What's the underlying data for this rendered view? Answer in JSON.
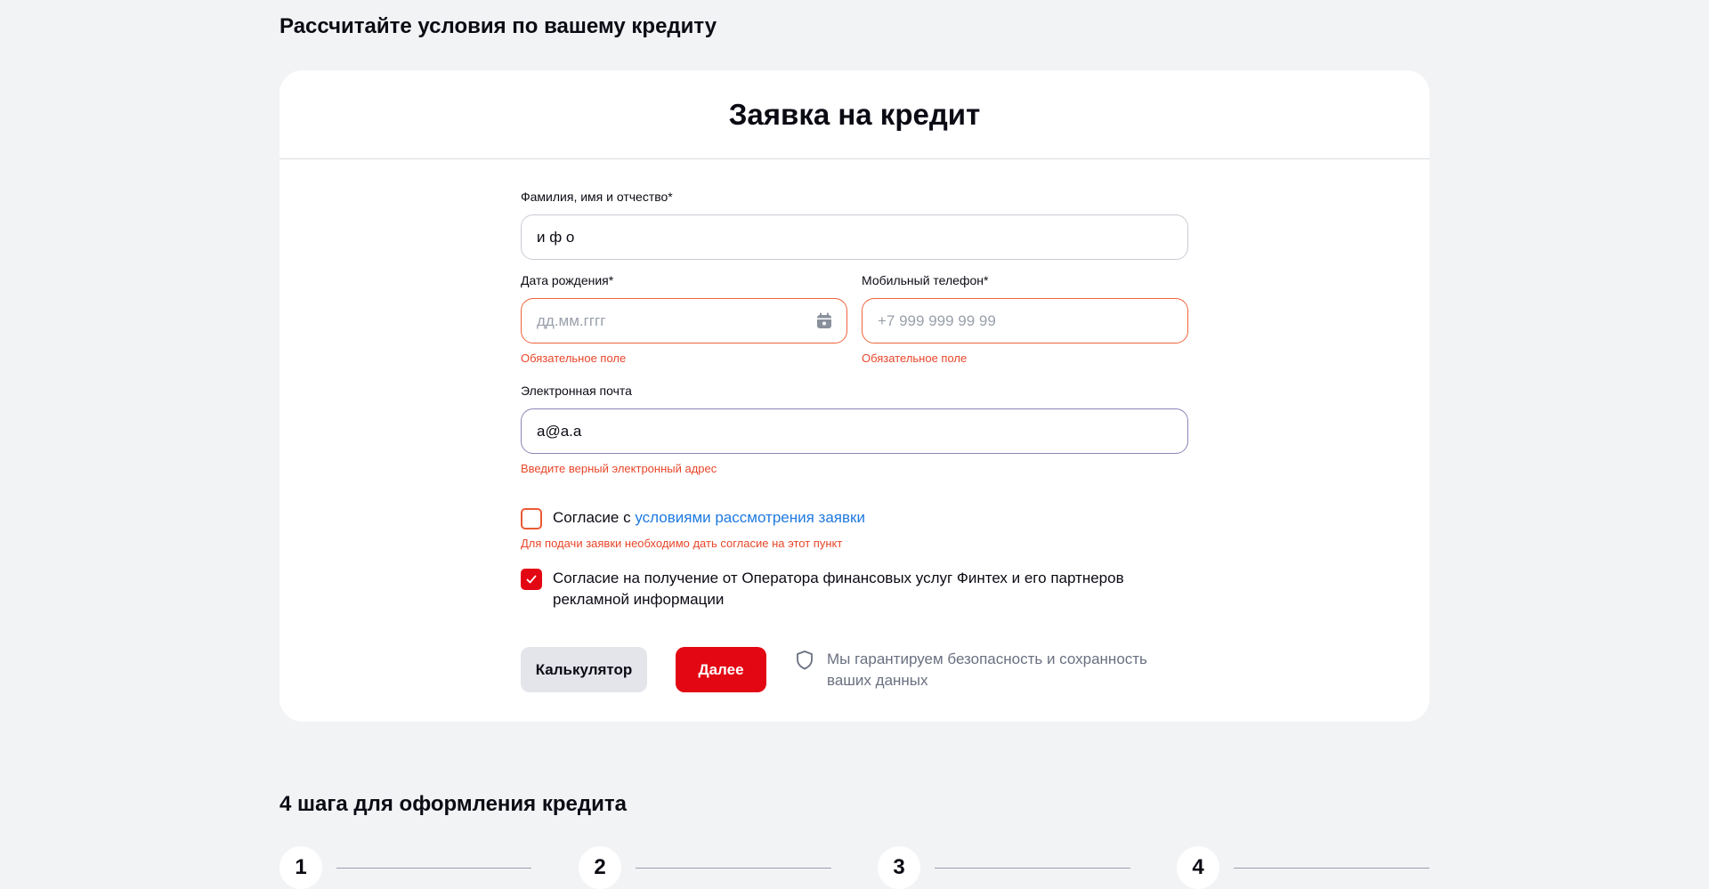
{
  "page": {
    "section_title": "Рассчитайте условия по вашему кредиту",
    "steps_title": "4 шага для оформления кредита"
  },
  "form": {
    "title": "Заявка на кредит",
    "fio": {
      "label": "Фамилия, имя и отчество*",
      "value": "и ф о"
    },
    "birthdate": {
      "label": "Дата рождения*",
      "placeholder": "дд.мм.гггг",
      "error": "Обязательное поле",
      "icon": "calendar-icon"
    },
    "phone": {
      "label": "Мобильный телефон*",
      "placeholder": "+7 999 999 99 99",
      "error": "Обязательное поле"
    },
    "email": {
      "label": "Электронная почта",
      "value": "a@a.a",
      "error": "Введите верный электронный адрес"
    },
    "consent_terms": {
      "text": "Согласие с ",
      "link": "условиями рассмотрения заявки",
      "checked": false,
      "error": "Для подачи заявки необходимо дать согласие на этот пункт"
    },
    "consent_ads": {
      "text": "Согласие на получение от Оператора финансовых услуг Финтех и его партнеров рекламной информации",
      "checked": true
    },
    "calc_button": "Калькулятор",
    "next_button": "Далее",
    "security_note": "Мы гарантируем безопасность и сохранность ваших данных",
    "security_icon": "shield-icon"
  },
  "steps": [
    "1",
    "2",
    "3",
    "4"
  ],
  "colors": {
    "accent": "#e30613",
    "error": "#e8462a",
    "link": "#1f7ae0",
    "background": "#f2f3f5"
  }
}
